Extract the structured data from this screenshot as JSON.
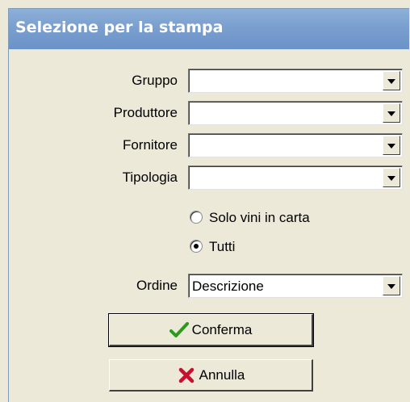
{
  "window": {
    "title": "Selezione per la stampa"
  },
  "fields": {
    "gruppo": {
      "label": "Gruppo",
      "value": ""
    },
    "produttore": {
      "label": "Produttore",
      "value": ""
    },
    "fornitore": {
      "label": "Fornitore",
      "value": ""
    },
    "tipologia": {
      "label": "Tipologia",
      "value": ""
    },
    "ordine": {
      "label": "Ordine",
      "value": "Descrizione"
    }
  },
  "filter": {
    "options": [
      {
        "label": "Solo vini in carta",
        "checked": false
      },
      {
        "label": "Tutti",
        "checked": true
      }
    ]
  },
  "buttons": {
    "confirm_label": "Conferma",
    "cancel_label": "Annulla"
  },
  "icons": {
    "confirm": "check-icon",
    "cancel": "x-mark-icon"
  },
  "colors": {
    "title_bar": "#7a9fcf",
    "check_green": "#2e9a1d",
    "cross_red": "#c8102e"
  }
}
